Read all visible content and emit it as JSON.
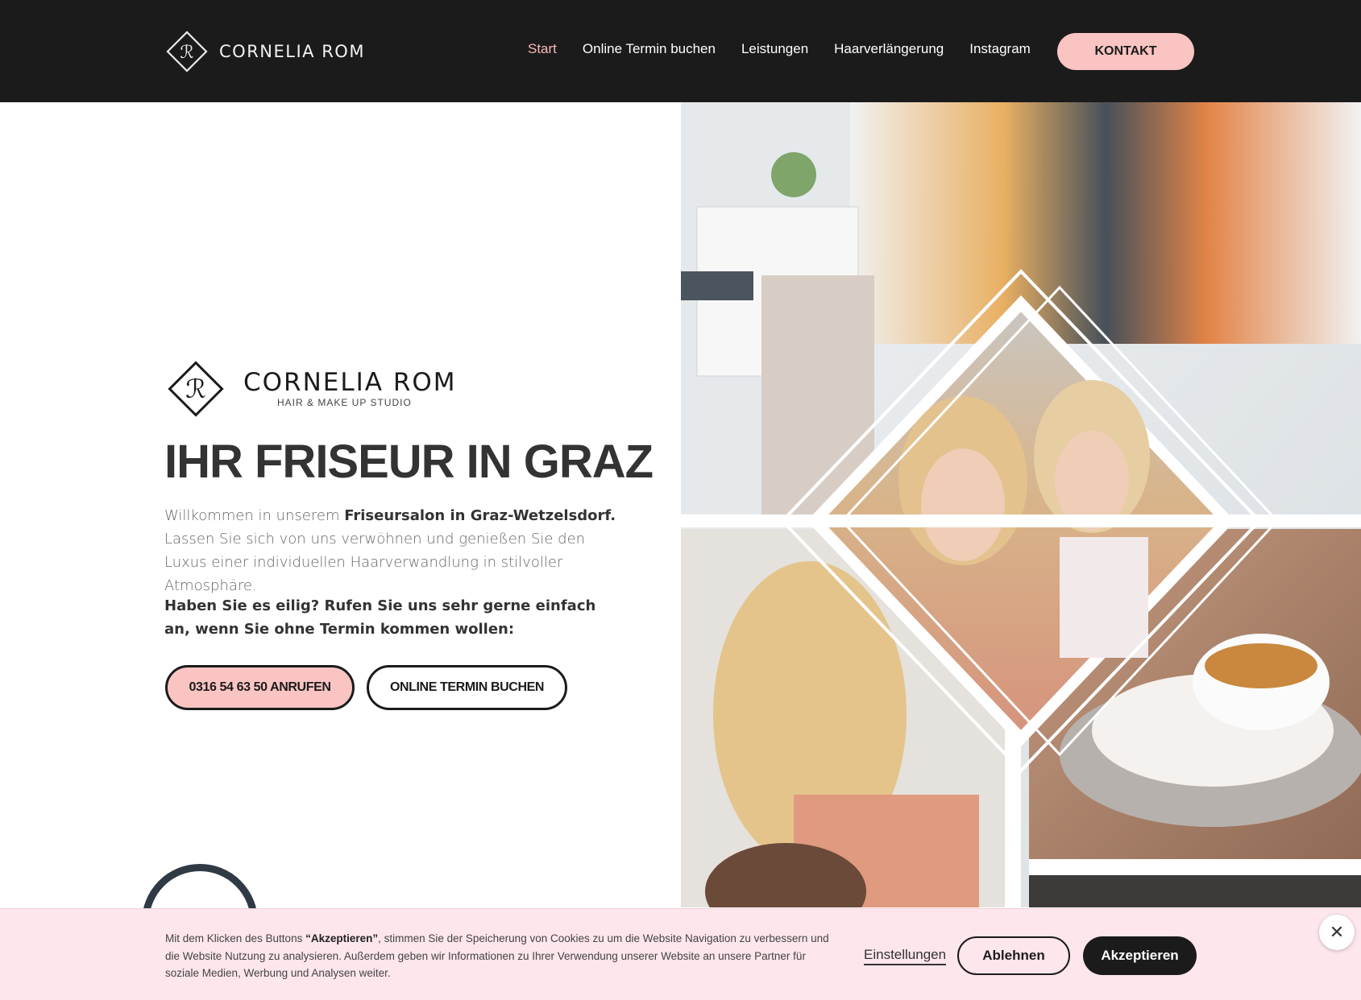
{
  "colors": {
    "header_bg": "#1b1b1c",
    "accent_pink": "#f9c4c1",
    "nav_active": "#f8b9b7",
    "cookie_bg": "#fde6ec"
  },
  "header": {
    "brand": "CORNELIA ROM",
    "logo_icon": "cr-diamond-logo",
    "nav": [
      {
        "label": "Start",
        "active": true
      },
      {
        "label": "Online Termin buchen",
        "active": false
      },
      {
        "label": "Leistungen",
        "active": false
      },
      {
        "label": "Haarverlängerung",
        "active": false
      },
      {
        "label": "Instagram",
        "active": false
      }
    ],
    "contact_label": "KONTAKT"
  },
  "hero": {
    "logo_name": "CORNELIA ROM",
    "logo_tagline": "HAIR & MAKE UP STUDIO",
    "title": "IHR FRISEUR IN GRAZ",
    "intro_prefix": "Willkommen in unserem ",
    "intro_bold": "Friseursalon in Graz-Wetzelsdorf.",
    "intro_suffix": " Lassen Sie sich von uns verwöhnen und genießen Sie den Luxus einer individuellen Haarverwandlung in stilvoller Atmosphäre.",
    "urgent": "Haben Sie es eilig? Rufen Sie uns sehr gerne einfach an, wenn Sie ohne Termin kommen wollen:",
    "call_button": "0316 54 63 50 ANRUFEN",
    "book_button": "ONLINE TERMIN BUCHEN",
    "image_icon": "salon-collage-image"
  },
  "cookie": {
    "text_prefix": "Mit dem Klicken des Buttons ",
    "text_bold": "“Akzeptieren”",
    "text_suffix": ", stimmen Sie der Speicherung von Cookies zu um die Website Navigation zu verbessern und die Website Nutzung zu analysieren. Außerdem geben wir Informationen zu Ihrer Verwendung unserer Website an unsere Partner für soziale Medien, Werbung und Analysen weiter.",
    "settings_label": "Einstellungen",
    "decline_label": "Ablehnen",
    "accept_label": "Akzeptieren",
    "close_icon": "close-icon"
  }
}
